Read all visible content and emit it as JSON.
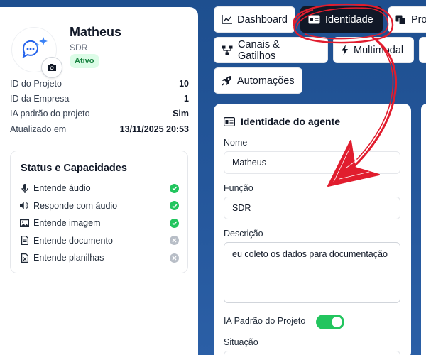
{
  "profile": {
    "name": "Matheus",
    "role": "SDR",
    "status": "Ativo",
    "meta": [
      {
        "key": "ID do Projeto",
        "value": "10"
      },
      {
        "key": "ID da Empresa",
        "value": "1"
      },
      {
        "key": "IA padrão do projeto",
        "value": "Sim"
      },
      {
        "key": "Atualizado em",
        "value": "13/11/2025 20:53"
      }
    ]
  },
  "capabilities": {
    "title": "Status e Capacidades",
    "items": [
      {
        "label": "Entende áudio",
        "icon": "microphone-icon",
        "enabled": true
      },
      {
        "label": "Responde com áudio",
        "icon": "speaker-icon",
        "enabled": true
      },
      {
        "label": "Entende imagem",
        "icon": "image-icon",
        "enabled": true
      },
      {
        "label": "Entende documento",
        "icon": "document-icon",
        "enabled": false
      },
      {
        "label": "Entende planilhas",
        "icon": "spreadsheet-icon",
        "enabled": false
      }
    ]
  },
  "tabs": [
    {
      "label": "Dashboard",
      "icon": "chart-line-icon"
    },
    {
      "label": "Identidade",
      "icon": "id-card-icon",
      "active": true
    },
    {
      "label": "Pro",
      "icon": "copy-icon"
    },
    {
      "label": "Canais & Gatilhos",
      "icon": "network-icon"
    },
    {
      "label": "Multimodal",
      "icon": "bolt-icon"
    },
    {
      "label": "Automações",
      "icon": "rocket-icon"
    }
  ],
  "identity": {
    "title": "Identidade do agente",
    "name_label": "Nome",
    "name_value": "Matheus",
    "role_label": "Função",
    "role_value": "SDR",
    "description_label": "Descrição",
    "description_value": "eu coleto os dados para documentação",
    "default_ai_label": "IA Padrão do Projeto",
    "default_ai_on": true,
    "situation_label": "Situação"
  },
  "colors": {
    "background": "#24569a",
    "active_tab": "#111827",
    "enabled": "#22c55e",
    "disabled": "#b8bec7",
    "annotation": "#e11d2e"
  }
}
